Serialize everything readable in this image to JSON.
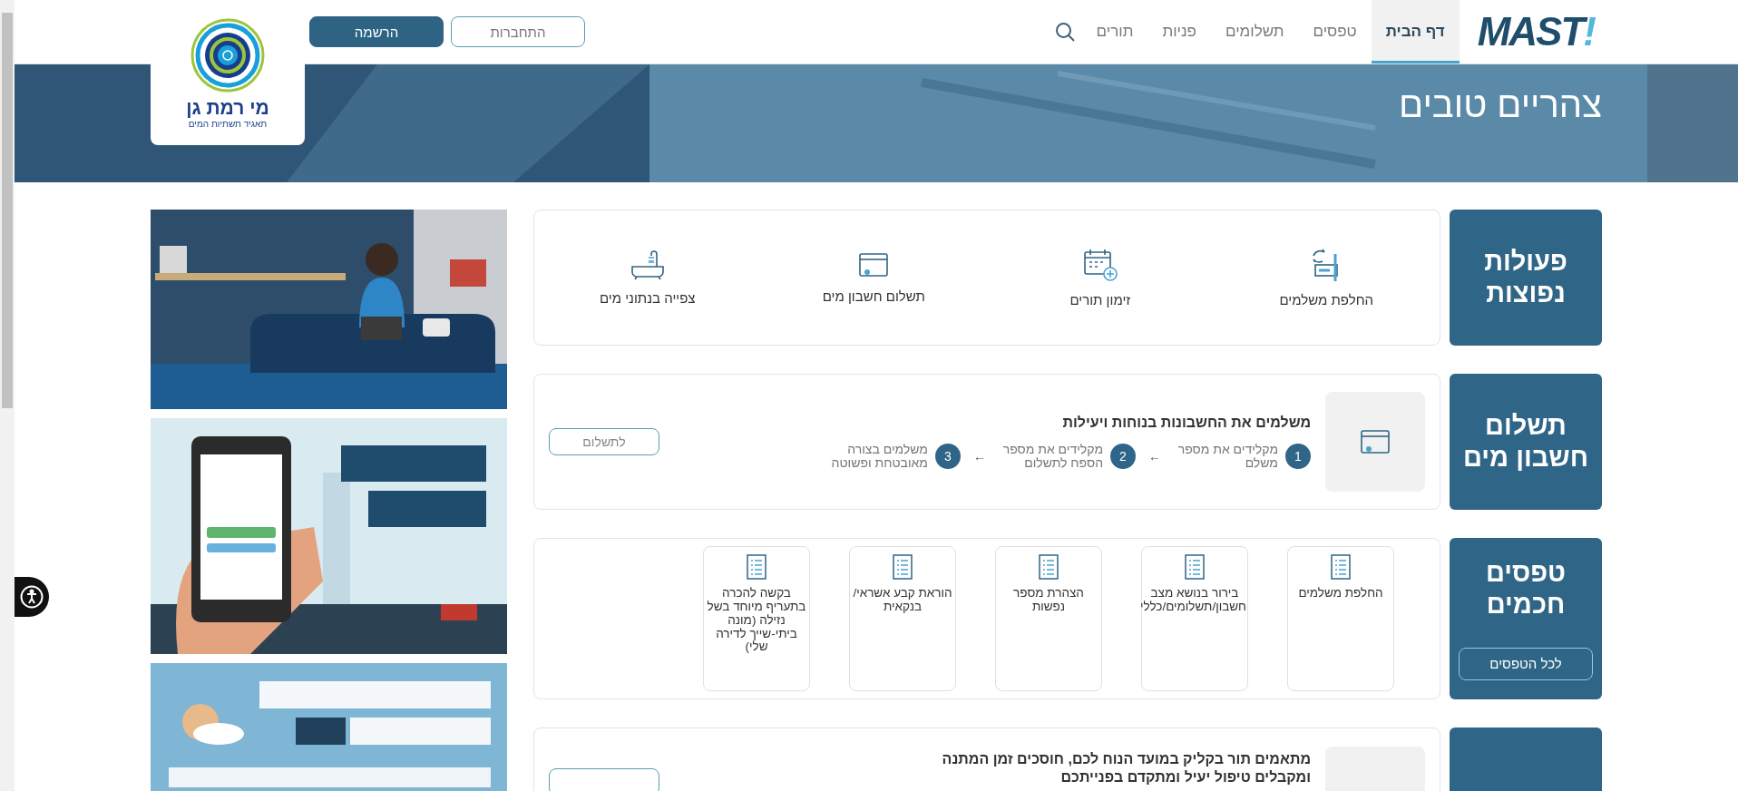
{
  "header": {
    "brand": {
      "name": "MAST",
      "mark": "!"
    },
    "nav": [
      {
        "label": "דף הבית",
        "selected": true
      },
      {
        "label": "טפסים",
        "selected": false
      },
      {
        "label": "תשלומים",
        "selected": false
      },
      {
        "label": "פניות",
        "selected": false
      },
      {
        "label": "תורים",
        "selected": false
      }
    ],
    "auth_buttons": [
      {
        "label": "התחברות",
        "kind": "outline"
      },
      {
        "label": "הרשמה",
        "kind": "filled"
      }
    ],
    "partner_logo": {
      "name": "מי רמת גן",
      "tagline": "תאגיד תשתיות המים"
    }
  },
  "hero": {
    "greeting": "צהריים טובים"
  },
  "quick_actions": {
    "title": "פעולות נפוצות",
    "items": [
      {
        "label": "החלפת משלמים",
        "kind": "swap"
      },
      {
        "label": "זימון תורים",
        "kind": "calendar"
      },
      {
        "label": "תשלום חשבון מים",
        "kind": "wallet"
      },
      {
        "label": "צפייה בנתוני מים",
        "kind": "bath"
      }
    ]
  },
  "water_bill": {
    "title": "תשלום חשבון מים",
    "heading": "משלמים את החשבונות בנוחות ויעילות",
    "separator": "←",
    "steps": [
      {
        "number": "1",
        "text": "מקלידים את מספר משלם"
      },
      {
        "number": "2",
        "text": "מקלידים את מספר הספח לתשלום"
      },
      {
        "number": "3",
        "text": "משלמים בצורה מאובטחת ופשוטה"
      }
    ],
    "button": "לתשלום"
  },
  "smart_forms": {
    "title": "טפסים חכמים",
    "button": "לכל הטפסים",
    "forms": [
      {
        "label": "החלפת משלמים"
      },
      {
        "label": "בירור בנושא מצב חשבון/תשלומים/כללי"
      },
      {
        "label": "הצהרת מספר נפשות"
      },
      {
        "label": "הוראת קבע אשראי/ בנקאית"
      },
      {
        "label": "בקשה להכרה בתעריף מיוחד בשל נזילה (מונה ביתי-שייך לדירה שלי)"
      }
    ]
  },
  "appointments": {
    "text": "מתאמים תור בקליק במועד הנוח לכם, חוסכים זמן המתנה ומקבלים טיפול יעיל ומתקדם בפנייתכם"
  }
}
